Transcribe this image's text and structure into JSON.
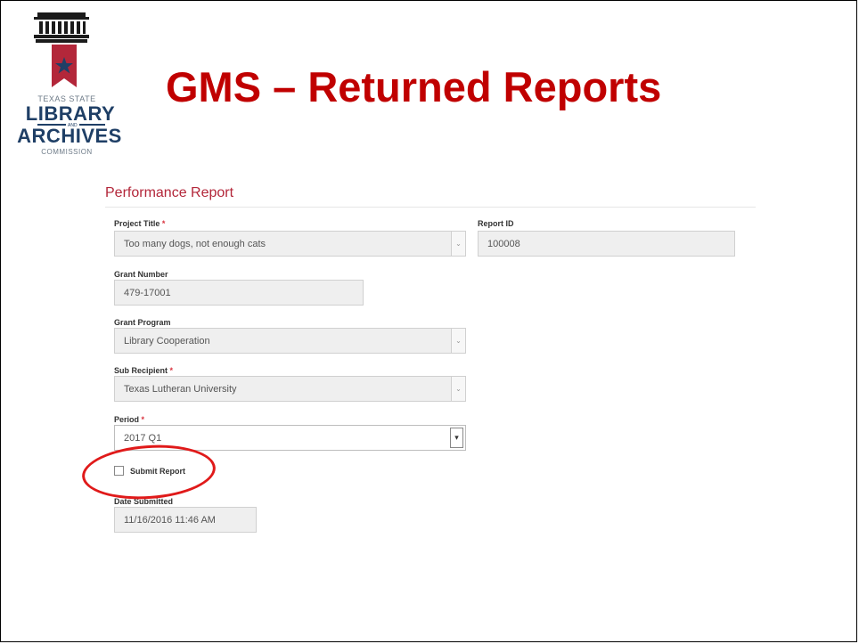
{
  "logo": {
    "line1": "TEXAS STATE",
    "line2": "LIBRARY",
    "line_and": "AND",
    "line3": "ARCHIVES",
    "line4": "COMMISSION"
  },
  "slide_title": "GMS – Returned Reports",
  "form": {
    "title": "Performance Report",
    "fields": {
      "project_title": {
        "label": "Project Title",
        "required": "*",
        "value": "Too many dogs, not enough cats"
      },
      "report_id": {
        "label": "Report ID",
        "value": "100008"
      },
      "grant_number": {
        "label": "Grant Number",
        "value": "479-17001"
      },
      "grant_program": {
        "label": "Grant Program",
        "value": "Library Cooperation"
      },
      "sub_recipient": {
        "label": "Sub Recipient",
        "required": "*",
        "value": "Texas Lutheran University"
      },
      "period": {
        "label": "Period",
        "required": "*",
        "value": "2017 Q1"
      },
      "submit_report": {
        "label": "Submit Report",
        "checked": false
      },
      "date_submitted": {
        "label": "Date Submitted",
        "value": "11/16/2016 11:46 AM"
      }
    }
  },
  "colors": {
    "title_red": "#c00000",
    "form_title": "#b3273a",
    "logo_navy": "#1f3f66",
    "annotation_red": "#e01a1a"
  },
  "icons": {
    "dropdown": "chevron-down-icon"
  }
}
